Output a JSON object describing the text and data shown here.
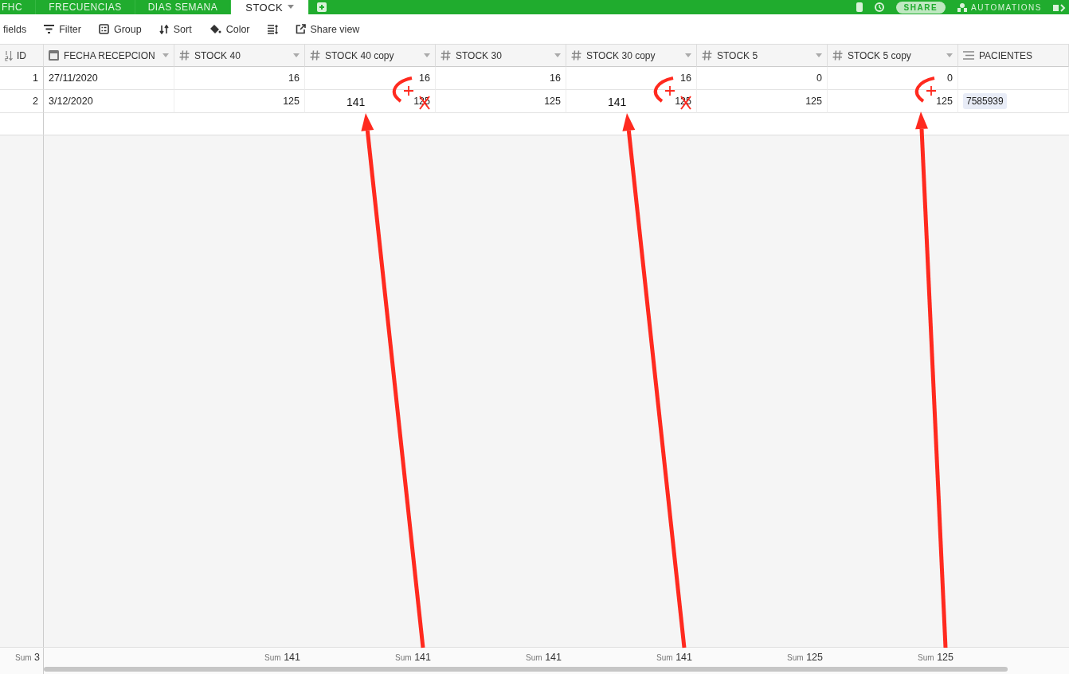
{
  "tabs": [
    {
      "label": "FHC",
      "selected": false
    },
    {
      "label": "FRECUENCIAS",
      "selected": false
    },
    {
      "label": "DIAS SEMANA",
      "selected": false
    },
    {
      "label": "STOCK",
      "selected": true
    }
  ],
  "top_actions": {
    "share": "SHARE",
    "automations": "AUTOMATIONS"
  },
  "toolbar": [
    {
      "kind": "fields",
      "label": "fields"
    },
    {
      "kind": "filter",
      "label": "Filter"
    },
    {
      "kind": "group",
      "label": "Group"
    },
    {
      "kind": "sort",
      "label": "Sort"
    },
    {
      "kind": "color",
      "label": "Color"
    },
    {
      "kind": "height"
    },
    {
      "kind": "share",
      "label": "Share view"
    }
  ],
  "primary_column": {
    "name": "ID",
    "summary": {
      "label": "Sum",
      "value": "3"
    }
  },
  "columns": [
    {
      "name": "FECHA RECEPCION",
      "kind": "date"
    },
    {
      "name": "STOCK 40",
      "kind": "number",
      "summary": {
        "label": "Sum",
        "value": "141"
      }
    },
    {
      "name": "STOCK 40 copy",
      "kind": "number",
      "summary": {
        "label": "Sum",
        "value": "141"
      },
      "annotation": {
        "arrow": true,
        "plus": true,
        "cross": true,
        "note": "141"
      }
    },
    {
      "name": "STOCK 30",
      "kind": "number",
      "summary": {
        "label": "Sum",
        "value": "141"
      }
    },
    {
      "name": "STOCK 30 copy",
      "kind": "number",
      "summary": {
        "label": "Sum",
        "value": "141"
      },
      "annotation": {
        "arrow": true,
        "plus": true,
        "cross": true,
        "note": "141"
      }
    },
    {
      "name": "STOCK 5",
      "kind": "number",
      "summary": {
        "label": "Sum",
        "value": "125"
      }
    },
    {
      "name": "STOCK 5 copy",
      "kind": "number",
      "summary": {
        "label": "Sum",
        "value": "125"
      },
      "annotation": {
        "arrow": true,
        "plus": true,
        "cross": false
      }
    },
    {
      "name": "PACIENTES",
      "kind": "link"
    }
  ],
  "rows": [
    {
      "id": "1",
      "cells": [
        "27/11/2020",
        "16",
        "16",
        "16",
        "16",
        "0",
        "0",
        null
      ]
    },
    {
      "id": "2",
      "cells": [
        "3/12/2020",
        "125",
        "125",
        "125",
        "125",
        "125",
        "125",
        [
          "7585939"
        ]
      ]
    }
  ]
}
